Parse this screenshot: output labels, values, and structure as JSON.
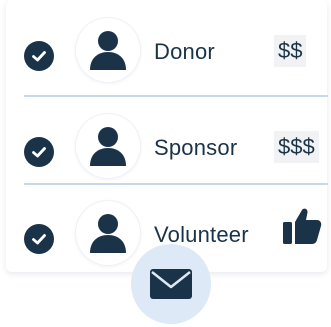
{
  "rows": [
    {
      "name": "Donor",
      "cost": "$$",
      "icon": "person-icon",
      "status": "checked"
    },
    {
      "name": "Sponsor",
      "cost": "$$$",
      "icon": "person-icon",
      "status": "checked"
    },
    {
      "name": "Volunteer",
      "cost_icon": "thumbs-up-icon",
      "icon": "person-icon",
      "status": "checked"
    }
  ],
  "colors": {
    "primary": "#1b3349",
    "divider": "#c9d7ea",
    "mail_button_bg": "#dde9f6",
    "cost_bg": "#f1f2f4"
  },
  "actions": {
    "mail_icon": "envelope-icon"
  }
}
